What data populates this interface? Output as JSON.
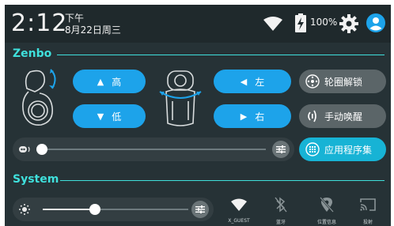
{
  "status": {
    "time": "2:12",
    "ampm": "下午",
    "date": "8月22日周三",
    "battery": "100%"
  },
  "zenbo": {
    "title": "Zenbo",
    "buttons": {
      "up": "高",
      "down": "低",
      "left": "左",
      "right": "右",
      "unlock_wheel": "轮圈解锁",
      "manual_wake": "手动唤醒",
      "apps": "应用程序集"
    },
    "volume_level": 0.0
  },
  "system": {
    "title": "System",
    "brightness_level": 0.36,
    "tiles": [
      {
        "label": "X_GUEST",
        "icon": "wifi-icon"
      },
      {
        "label": "蓝牙",
        "icon": "bluetooth-off-icon"
      },
      {
        "label": "位置信息",
        "icon": "location-off-icon"
      },
      {
        "label": "投射",
        "icon": "cast-icon"
      }
    ]
  },
  "colors": {
    "panel": "#263236",
    "accent": "#3fe0dc",
    "blue_button": "#1da3ea",
    "gray_button": "#5b6568",
    "teal_button": "#17b3d5"
  }
}
